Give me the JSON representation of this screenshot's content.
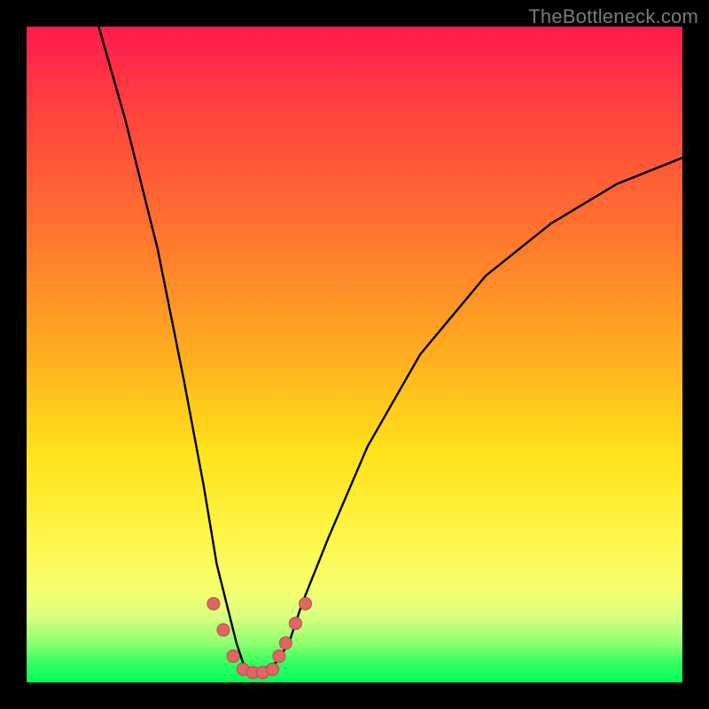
{
  "watermark": "TheBottleneck.com",
  "colors": {
    "frame": "#000000",
    "curve": "#000000",
    "marker_fill": "#e06666",
    "marker_stroke": "#b84a4a",
    "gradient_top": "#ff1a4d",
    "gradient_bottom": "#00ff57"
  },
  "chart_data": {
    "type": "line",
    "title": "",
    "xlabel": "",
    "ylabel": "",
    "xlim": [
      0,
      100
    ],
    "ylim": [
      0,
      100
    ],
    "origin": "bottom-left",
    "note": "x is relative component strength (0–100); y is bottleneck severity percent (0 best/green at bottom, 100 worst/red at top). Curve is a V with asymmetric arms; markers sit along the valley at low severity.",
    "series": [
      {
        "name": "bottleneck-curve",
        "x": [
          11,
          15,
          20,
          24,
          27,
          29,
          31,
          32,
          33,
          34,
          36,
          38,
          40,
          42,
          46,
          52,
          60,
          70,
          80,
          90,
          100
        ],
        "y": [
          100,
          86,
          66,
          46,
          30,
          18,
          10,
          6,
          3,
          2,
          2,
          3,
          6,
          12,
          22,
          36,
          50,
          62,
          70,
          76,
          80
        ]
      }
    ],
    "markers": {
      "name": "sample-points",
      "x": [
        28.5,
        30,
        31.5,
        33,
        34.5,
        36,
        37.5,
        38.5,
        39.5,
        41,
        42.5
      ],
      "y": [
        12,
        8,
        4,
        2,
        1.5,
        1.5,
        2,
        4,
        6,
        9,
        12
      ],
      "r": 7
    }
  }
}
